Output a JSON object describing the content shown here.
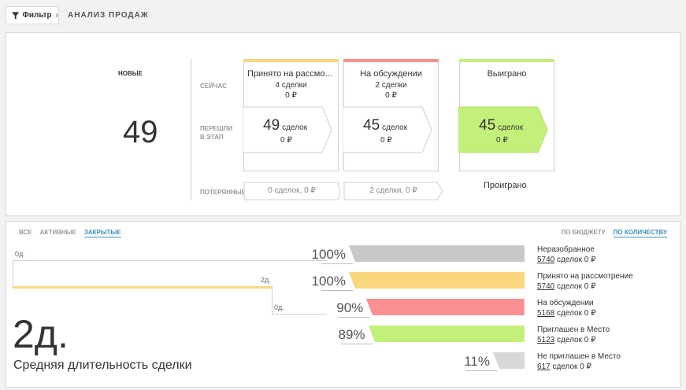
{
  "header": {
    "filter_label": "Фильтр",
    "filter_chevron": "›",
    "title": "АНАЛИЗ ПРОДАЖ"
  },
  "new_deals": {
    "label": "НОВЫЕ",
    "count": "49"
  },
  "row_labels": {
    "now": "СЕЙЧАС",
    "moved_line1": "ПЕРЕШЛИ",
    "moved_line2": "В ЭТАП",
    "lost": "ПОТЕРЯННЫЕ"
  },
  "stages": [
    {
      "title": "Принято на рассмотрение",
      "now_deals": "4 сделки",
      "now_amount": "0 ₽",
      "moved_count": "49",
      "moved_unit": "сделок",
      "moved_amount": "0 ₽",
      "lost_text": "0 сделок, 0 ₽",
      "color": "#fad77c"
    },
    {
      "title": "На обсуждении",
      "now_deals": "2 сделки",
      "now_amount": "0 ₽",
      "moved_count": "45",
      "moved_unit": "сделок",
      "moved_amount": "0 ₽",
      "lost_text": "2 сделки, 0 ₽",
      "color": "#fb8e8e"
    },
    {
      "title": "Выиграно",
      "moved_count": "45",
      "moved_unit": "сделок",
      "moved_amount": "0 ₽",
      "color": "#c3f07a"
    }
  ],
  "lost_title": "Проиграно",
  "tabs": [
    "ВСЕ",
    "АКТИВНЫЕ",
    "ЗАКРЫТЫЕ"
  ],
  "active_tab": "ЗАКРЫТЫЕ",
  "toggle": [
    "ПО БЮДЖЕТУ",
    "ПО КОЛИЧЕСТВУ"
  ],
  "active_toggle": "ПО КОЛИЧЕСТВУ",
  "timeline": {
    "label_start": "0д.",
    "label_mid": "2д.",
    "label_end": "0д."
  },
  "average": {
    "value": "2д.",
    "caption": "Средняя длительность сделки"
  },
  "funnel": [
    {
      "percent": "100%",
      "fill": 1.0,
      "name": "Неразобранное",
      "count": "5740",
      "rest": " сделок 0 ₽",
      "color": "#c8c8c8"
    },
    {
      "percent": "100%",
      "fill": 1.0,
      "name": "Принято на рассмотрение",
      "count": "5740",
      "rest": " сделок 0 ₽",
      "color": "#fad77c"
    },
    {
      "percent": "90%",
      "fill": 0.9,
      "name": "На обсуждении",
      "count": "5168",
      "rest": " сделок 0 ₽",
      "color": "#fb8e8e"
    },
    {
      "percent": "89%",
      "fill": 0.89,
      "name": "Приглашен в Место",
      "count": "5123",
      "rest": " сделок 0 ₽",
      "color": "#c3f07a"
    },
    {
      "percent": "11%",
      "fill": 0.11,
      "name": "Не приглашен в Место",
      "count": "617",
      "rest": " сделок 0 ₽",
      "color": "#d8d8d8"
    }
  ],
  "icons": {
    "filter": "funnel-icon"
  }
}
